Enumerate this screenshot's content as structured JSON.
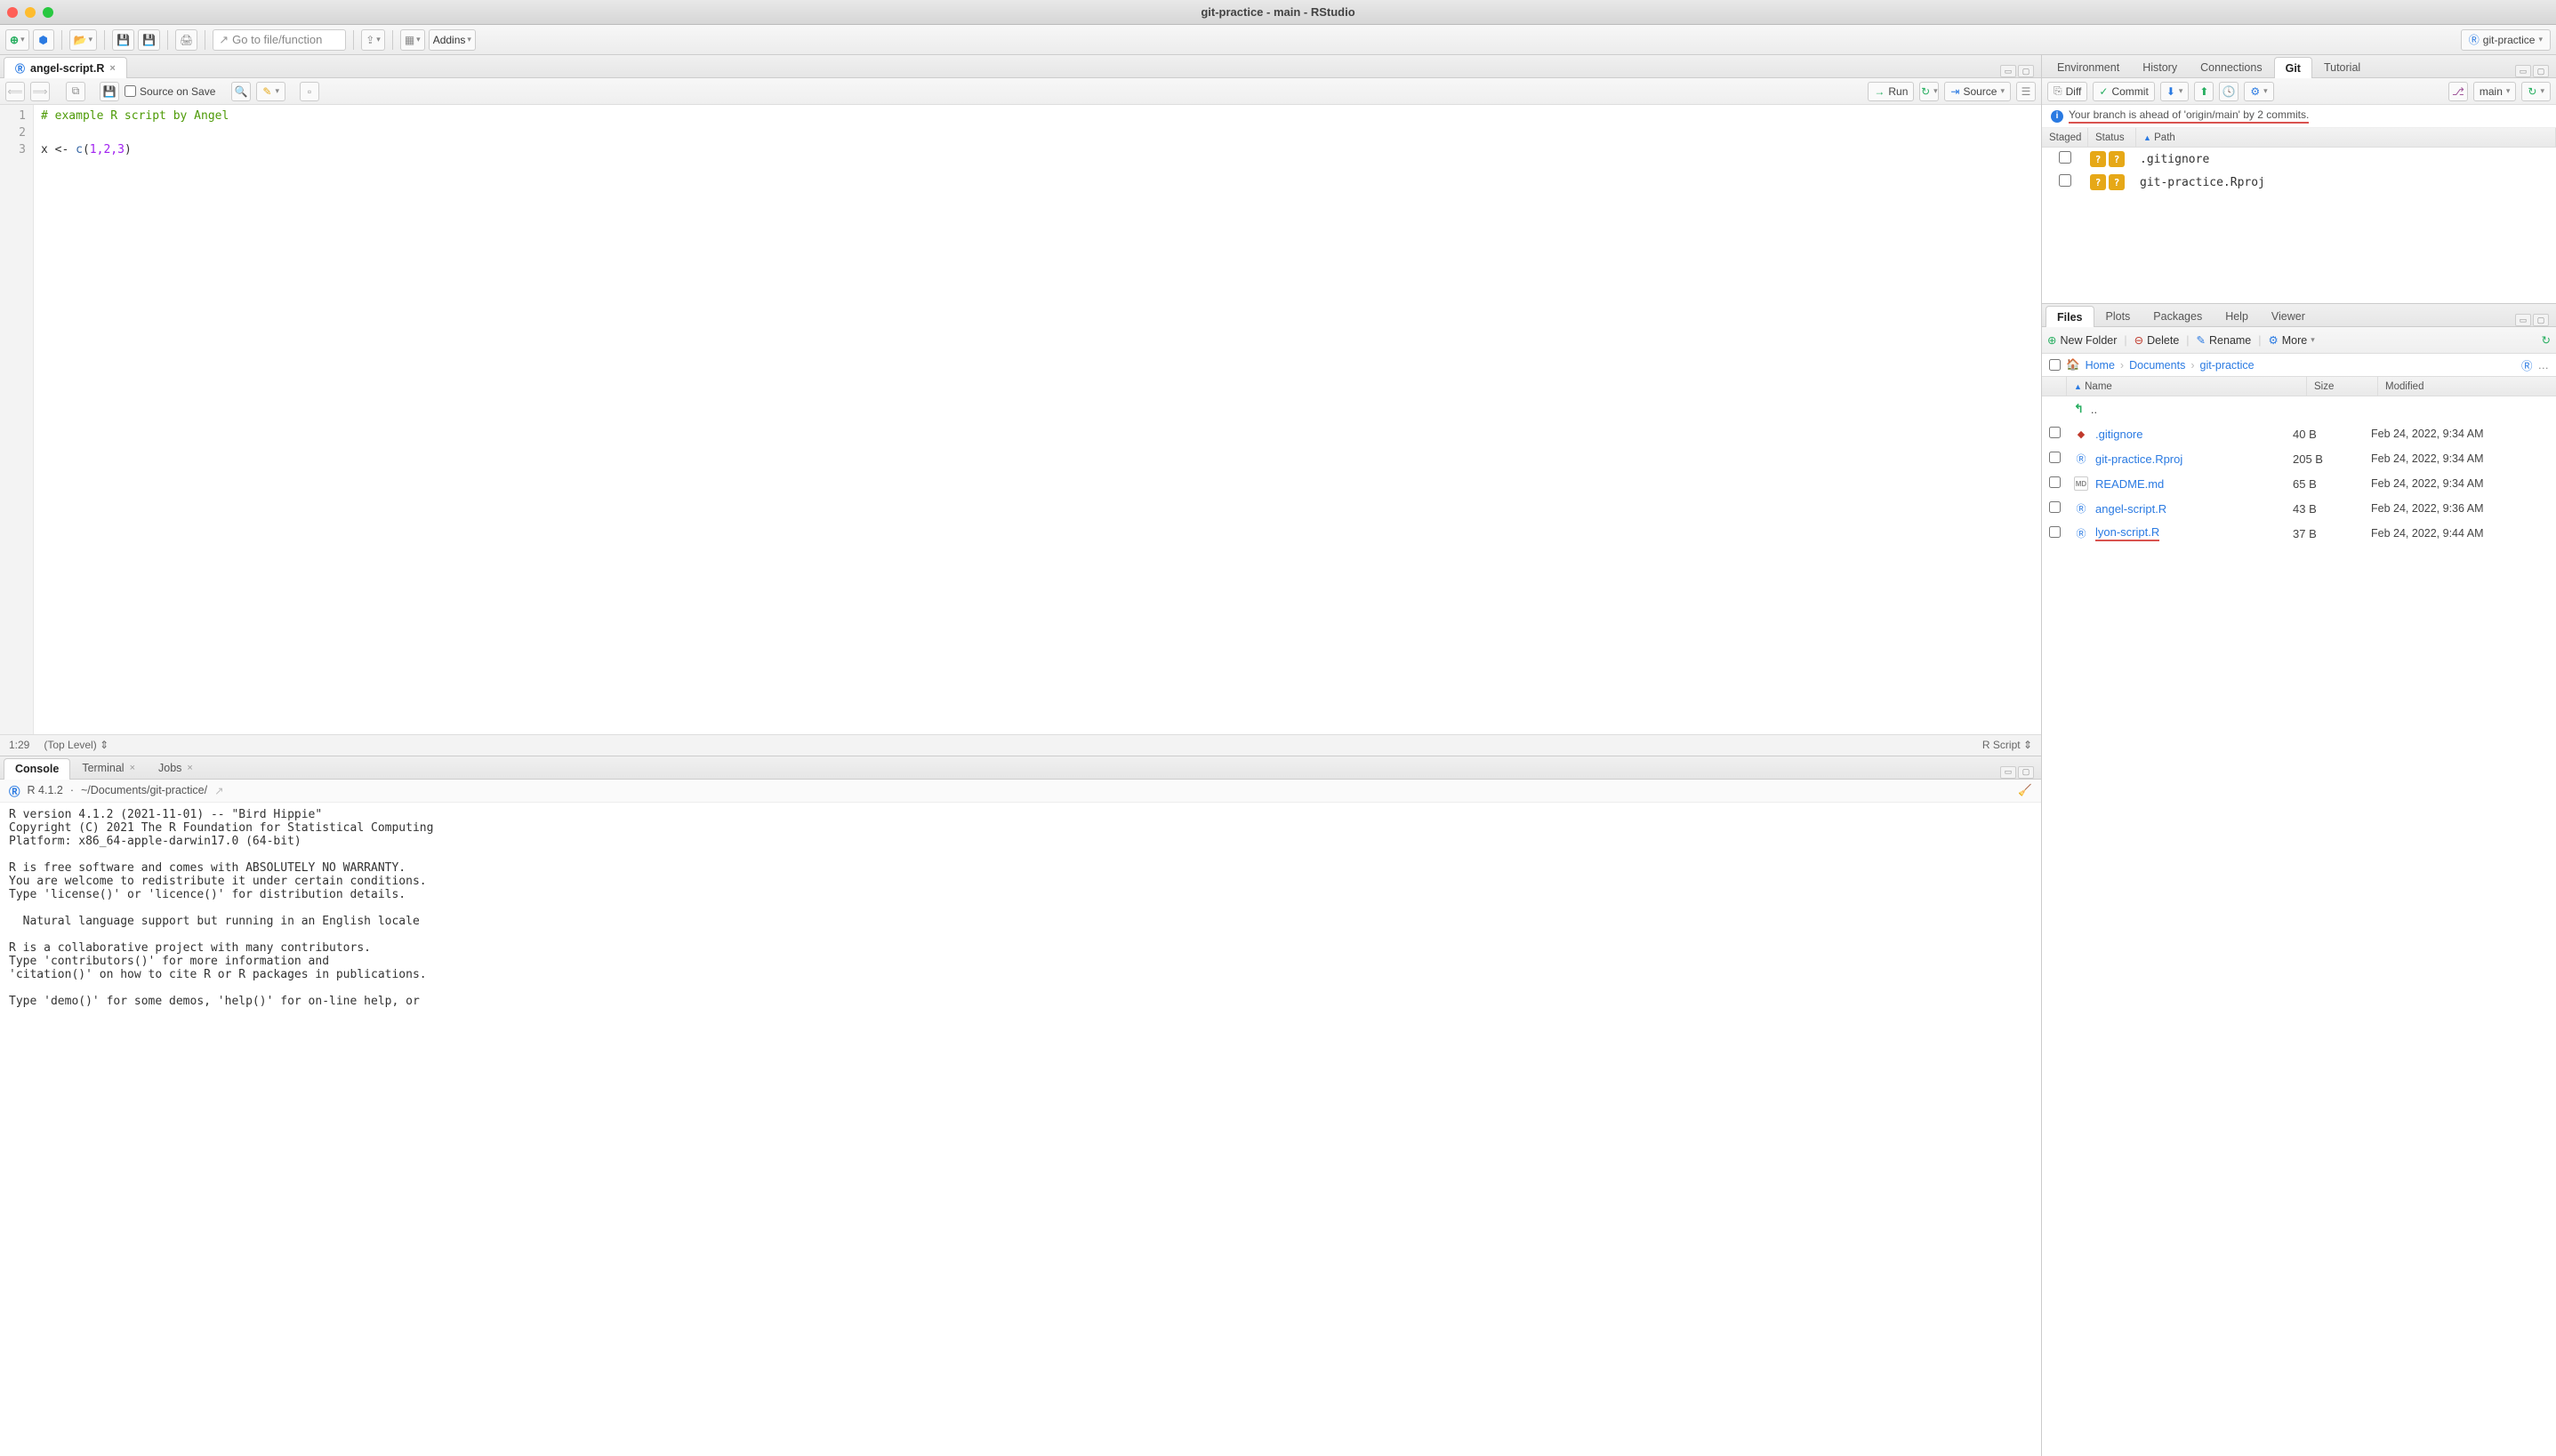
{
  "window_title": "git-practice - main - RStudio",
  "project_name": "git-practice",
  "toolbar": {
    "goto_placeholder": "Go to file/function",
    "addins_label": "Addins"
  },
  "editor": {
    "tab_name": "angel-script.R",
    "source_on_save": "Source on Save",
    "run_label": "Run",
    "source_label": "Source",
    "lines": [
      "1",
      "2",
      "3"
    ],
    "code_comment": "# example R script by Angel",
    "code_assign": "x <- ",
    "code_fn": "c",
    "code_open": "(",
    "code_args": "1,2,3",
    "code_close": ")",
    "cursor_pos": "1:29",
    "scope": "(Top Level)",
    "lang": "R Script"
  },
  "console": {
    "tabs": {
      "console": "Console",
      "terminal": "Terminal",
      "jobs": "Jobs"
    },
    "r_version": "R 4.1.2",
    "path": "~/Documents/git-practice/",
    "body": "R version 4.1.2 (2021-11-01) -- \"Bird Hippie\"\nCopyright (C) 2021 The R Foundation for Statistical Computing\nPlatform: x86_64-apple-darwin17.0 (64-bit)\n\nR is free software and comes with ABSOLUTELY NO WARRANTY.\nYou are welcome to redistribute it under certain conditions.\nType 'license()' or 'licence()' for distribution details.\n\n  Natural language support but running in an English locale\n\nR is a collaborative project with many contributors.\nType 'contributors()' for more information and\n'citation()' on how to cite R or R packages in publications.\n\nType 'demo()' for some demos, 'help()' for on-line help, or"
  },
  "top_right": {
    "tabs": {
      "env": "Environment",
      "hist": "History",
      "conn": "Connections",
      "git": "Git",
      "tut": "Tutorial"
    },
    "git_toolbar": {
      "diff": "Diff",
      "commit": "Commit",
      "branch": "main"
    },
    "git_msg": "Your branch is ahead of 'origin/main' by 2 commits.",
    "headers": {
      "staged": "Staged",
      "status": "Status",
      "path": "Path"
    },
    "rows": [
      {
        "path": ".gitignore"
      },
      {
        "path": "git-practice.Rproj"
      }
    ]
  },
  "bottom_right": {
    "tabs": {
      "files": "Files",
      "plots": "Plots",
      "pkg": "Packages",
      "help": "Help",
      "viewer": "Viewer"
    },
    "toolbar": {
      "newfolder": "New Folder",
      "delete": "Delete",
      "rename": "Rename",
      "more": "More"
    },
    "breadcrumb": {
      "home": "Home",
      "docs": "Documents",
      "proj": "git-practice"
    },
    "headers": {
      "name": "Name",
      "size": "Size",
      "modified": "Modified"
    },
    "updir": "..",
    "rows": [
      {
        "name": ".gitignore",
        "size": "40 B",
        "mod": "Feb 24, 2022, 9:34 AM",
        "icon": "git"
      },
      {
        "name": "git-practice.Rproj",
        "size": "205 B",
        "mod": "Feb 24, 2022, 9:34 AM",
        "icon": "proj"
      },
      {
        "name": "README.md",
        "size": "65 B",
        "mod": "Feb 24, 2022, 9:34 AM",
        "icon": "md"
      },
      {
        "name": "angel-script.R",
        "size": "43 B",
        "mod": "Feb 24, 2022, 9:36 AM",
        "icon": "r"
      },
      {
        "name": "lyon-script.R",
        "size": "37 B",
        "mod": "Feb 24, 2022, 9:44 AM",
        "icon": "r",
        "underline": true
      }
    ]
  }
}
